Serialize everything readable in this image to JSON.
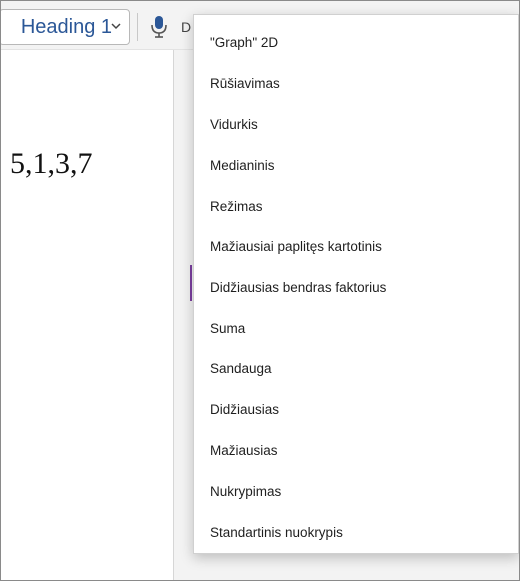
{
  "toolbar": {
    "style_value": "Heading 1",
    "dictate_label": "D"
  },
  "document": {
    "text": "5,1,3,7"
  },
  "math_menu": {
    "items": [
      "\"Graph\" 2D",
      "Rūšiavimas",
      "Vidurkis",
      "Medianinis",
      "Režimas",
      "Mažiausiai paplitęs kartotinis",
      "Didžiausias bendras faktorius",
      "Suma",
      "Sandauga",
      "Didžiausias",
      "Mažiausias",
      "Nukrypimas",
      "Standartinis nuokrypis"
    ]
  },
  "colors": {
    "style_text": "#2b5797",
    "caret_accent": "#7b3fa0",
    "mic_icon": "#2b5797"
  },
  "icons": {
    "style_chevron": "chevron-down-icon",
    "dictate": "microphone-icon"
  }
}
